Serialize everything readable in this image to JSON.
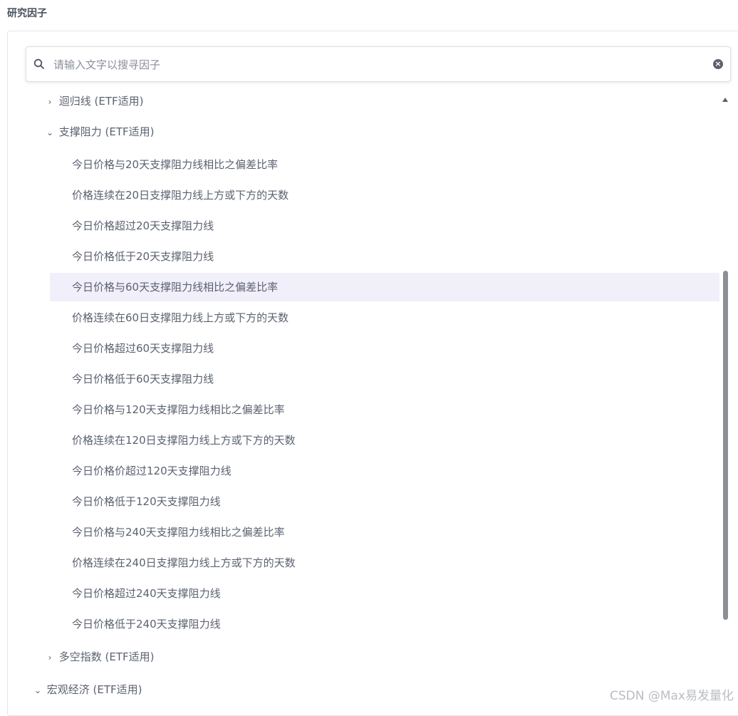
{
  "page": {
    "title": "研究因子"
  },
  "search": {
    "placeholder": "请输入文字以搜寻因子",
    "clear_symbol": "×"
  },
  "tree": {
    "nodes": [
      {
        "label": "迴归线 (ETF适用)",
        "expanded": false,
        "chevron": "›"
      },
      {
        "label": "支撑阻力 (ETF适用)",
        "expanded": true,
        "chevron": "⌄"
      },
      {
        "label": "多空指数 (ETF适用)",
        "expanded": false,
        "chevron": "›"
      },
      {
        "label": "宏观经济 (ETF适用)",
        "expanded": true,
        "chevron": "⌄"
      }
    ],
    "children": [
      "今日价格与20天支撑阻力线相比之偏差比率",
      "价格连续在20日支撑阻力线上方或下方的天数",
      "今日价格超过20天支撑阻力线",
      "今日价格低于20天支撑阻力线",
      "今日价格与60天支撑阻力线相比之偏差比率",
      "价格连续在60日支撑阻力线上方或下方的天数",
      "今日价格超过60天支撑阻力线",
      "今日价格低于60天支撑阻力线",
      "今日价格与120天支撑阻力线相比之偏差比率",
      "价格连续在120日支撑阻力线上方或下方的天数",
      "今日价格价超过120天支撑阻力线",
      "今日价格低于120天支撑阻力线",
      "今日价格与240天支撑阻力线相比之偏差比率",
      "价格连续在240日支撑阻力线上方或下方的天数",
      "今日价格超过240天支撑阻力线",
      "今日价格低于240天支撑阻力线"
    ],
    "selected_index": 4
  },
  "watermark": "CSDN @Max易发量化",
  "colors": {
    "selected_bg": "#f1effa",
    "text": "#5b6270"
  }
}
